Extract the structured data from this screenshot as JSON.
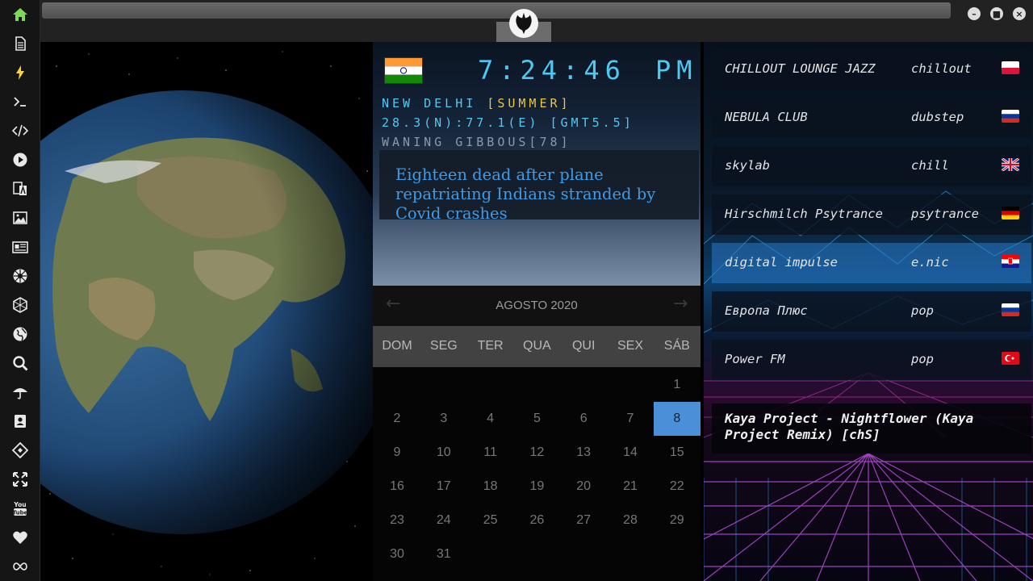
{
  "window": {
    "minimize": "–",
    "maximize": "■",
    "close": "×"
  },
  "clock": {
    "time": "7:24:46",
    "ampm": "PM",
    "city": "NEW DELHI",
    "season": "[SUMMER]",
    "coords": "28.3(N):77.1(E) [GMT5.5]",
    "moon": "WANING GIBBOUS[78]"
  },
  "news": {
    "headline": "Eighteen dead after plane repatriating Indians stranded by Covid crashes"
  },
  "calendar": {
    "title": "AGOSTO 2020",
    "prev": "←",
    "next": "→",
    "weekdays": [
      "DOM",
      "SEG",
      "TER",
      "QUA",
      "QUI",
      "SEX",
      "SÁB"
    ],
    "days": [
      "1",
      "2",
      "3",
      "4",
      "5",
      "6",
      "7",
      "8",
      "9",
      "10",
      "11",
      "12",
      "13",
      "14",
      "15",
      "16",
      "17",
      "18",
      "19",
      "20",
      "21",
      "22",
      "23",
      "24",
      "25",
      "26",
      "27",
      "28",
      "29",
      "30",
      "31"
    ],
    "first_weekday_index": 6,
    "today": "8"
  },
  "radio": {
    "stations": [
      {
        "name": "CHILLOUT LOUNGE JAZZ",
        "genre": "chillout",
        "flag": "pl"
      },
      {
        "name": "NEBULA CLUB",
        "genre": "dubstep",
        "flag": "ru"
      },
      {
        "name": "skylab",
        "genre": "chill",
        "flag": "gb"
      },
      {
        "name": "Hirschmilch Psytrance",
        "genre": "psytrance",
        "flag": "de"
      },
      {
        "name": "digital impulse",
        "genre": "e.nic",
        "flag": "hr"
      },
      {
        "name": "Европа Плюс",
        "genre": "pop",
        "flag": "ru"
      },
      {
        "name": "Power FM",
        "genre": "pop",
        "flag": "tr"
      }
    ],
    "selected_index": 4,
    "now_playing": "Kaya Project - Nightflower (Kaya Project Remix) [chS]"
  },
  "colors": {
    "accent": "#4a90d9",
    "clock": "#4dc9f2",
    "season": "#e8c64a",
    "home": "#7ed957"
  }
}
